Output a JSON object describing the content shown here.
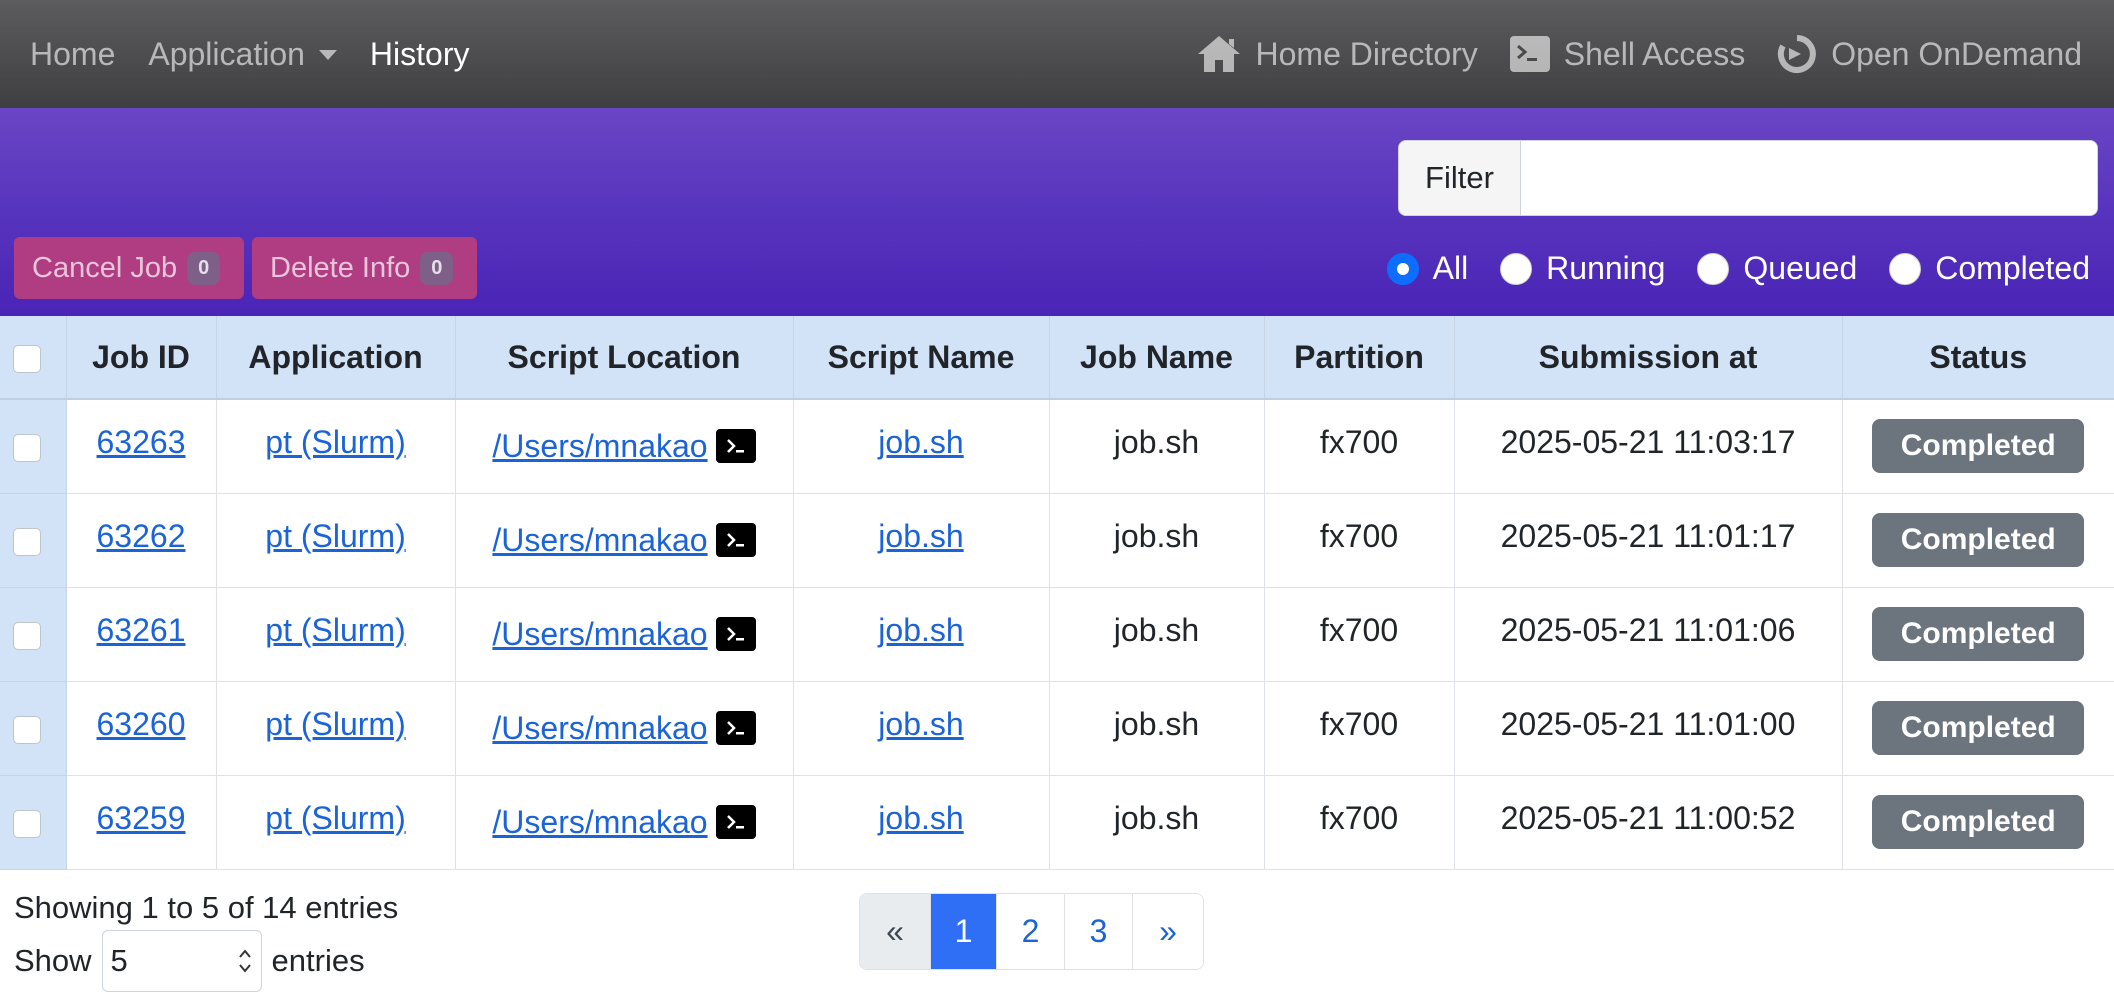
{
  "navbar": {
    "home": "Home",
    "application": "Application",
    "history": "History",
    "home_directory": "Home Directory",
    "shell_access": "Shell Access",
    "open_ondemand": "Open OnDemand"
  },
  "toolbar": {
    "filter_label": "Filter",
    "filter_value": "",
    "cancel_label": "Cancel Job",
    "cancel_count": "0",
    "delete_label": "Delete Info",
    "delete_count": "0",
    "status_filters": [
      {
        "label": "All",
        "checked": true
      },
      {
        "label": "Running",
        "checked": false
      },
      {
        "label": "Queued",
        "checked": false
      },
      {
        "label": "Completed",
        "checked": false
      }
    ]
  },
  "table": {
    "headers": [
      "Job ID",
      "Application",
      "Script Location",
      "Script Name",
      "Job Name",
      "Partition",
      "Submission at",
      "Status"
    ],
    "rows": [
      {
        "job_id": "63263",
        "application": "pt (Slurm)",
        "script_location": "/Users/mnakao",
        "script_name": "job.sh",
        "job_name": "job.sh",
        "partition": "fx700",
        "submitted": "2025-05-21 11:03:17",
        "status": "Completed"
      },
      {
        "job_id": "63262",
        "application": "pt (Slurm)",
        "script_location": "/Users/mnakao",
        "script_name": "job.sh",
        "job_name": "job.sh",
        "partition": "fx700",
        "submitted": "2025-05-21 11:01:17",
        "status": "Completed"
      },
      {
        "job_id": "63261",
        "application": "pt (Slurm)",
        "script_location": "/Users/mnakao",
        "script_name": "job.sh",
        "job_name": "job.sh",
        "partition": "fx700",
        "submitted": "2025-05-21 11:01:06",
        "status": "Completed"
      },
      {
        "job_id": "63260",
        "application": "pt (Slurm)",
        "script_location": "/Users/mnakao",
        "script_name": "job.sh",
        "job_name": "job.sh",
        "partition": "fx700",
        "submitted": "2025-05-21 11:01:00",
        "status": "Completed"
      },
      {
        "job_id": "63259",
        "application": "pt (Slurm)",
        "script_location": "/Users/mnakao",
        "script_name": "job.sh",
        "job_name": "job.sh",
        "partition": "fx700",
        "submitted": "2025-05-21 11:00:52",
        "status": "Completed"
      }
    ]
  },
  "footer": {
    "info": "Showing 1 to 5 of 14 entries",
    "show_label": "Show",
    "show_value": "5",
    "entries_label": "entries",
    "pagination": [
      "«",
      "1",
      "2",
      "3",
      "»"
    ],
    "current_page": "1"
  },
  "colors": {
    "navbar": "#4a4a4c",
    "band": "#5734bd",
    "action_button": "#b03d82",
    "table_header": "#d3e3f7",
    "link": "#1a63d8",
    "status_badge": "#6c757d",
    "active_page": "#2f6ff5"
  }
}
